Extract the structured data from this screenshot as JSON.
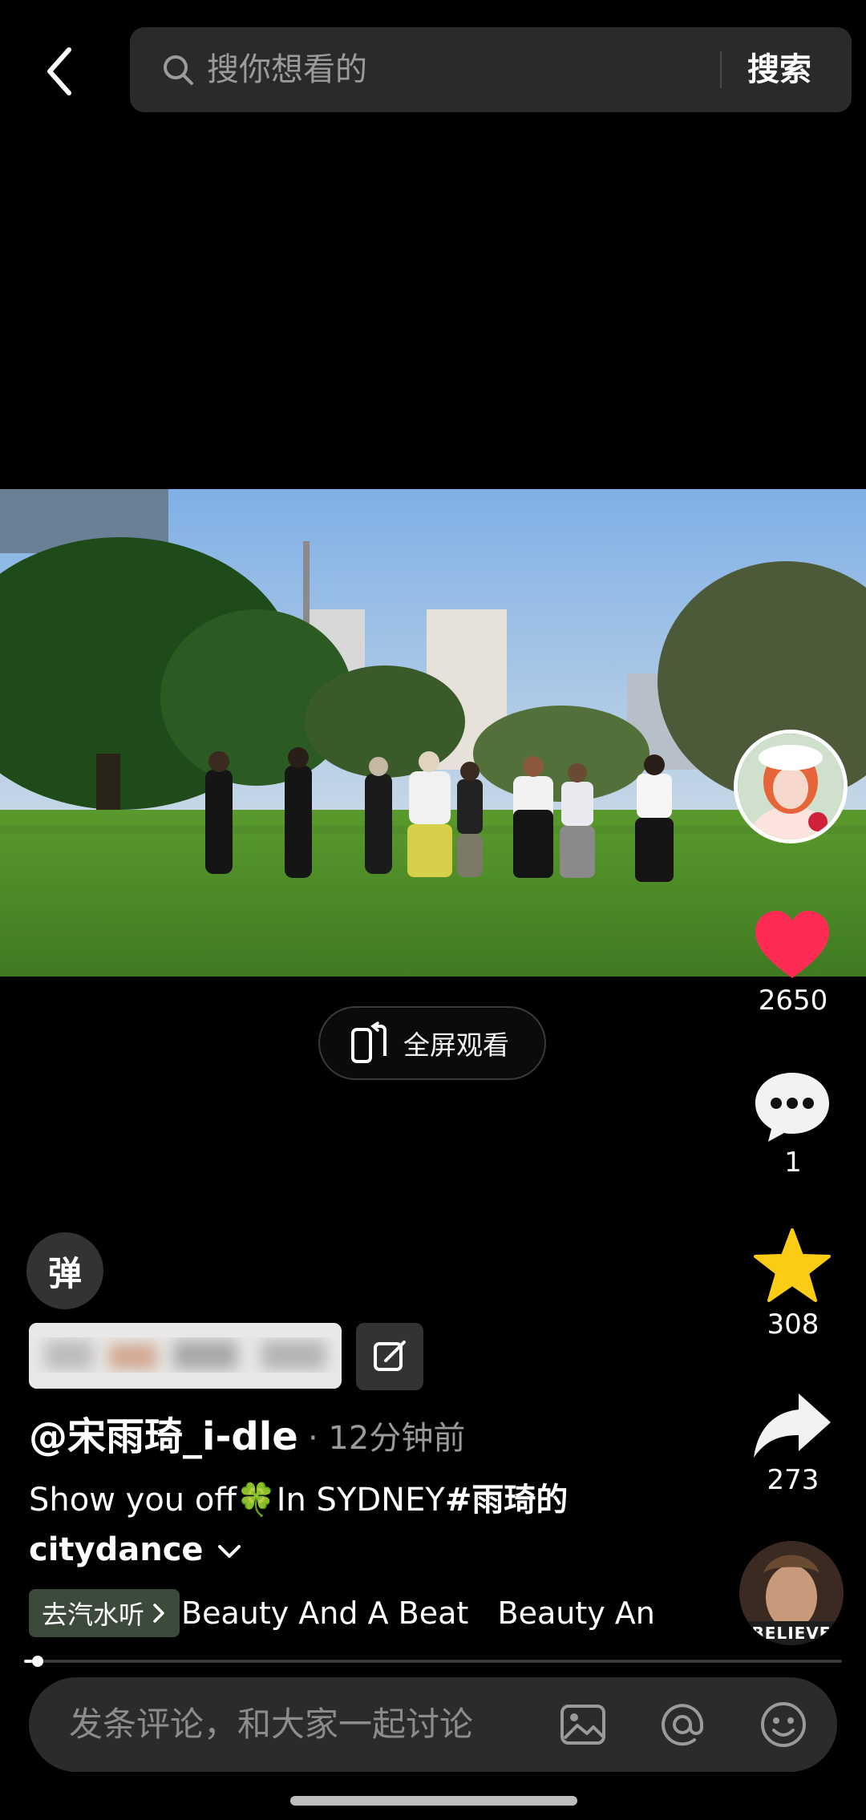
{
  "search": {
    "placeholder": "搜你想看的",
    "button_label": "搜索"
  },
  "video": {
    "fullscreen_label": "全屏观看"
  },
  "actions": {
    "like_count": "2650",
    "comment_count": "1",
    "favorite_count": "308",
    "share_count": "273"
  },
  "danmaku": {
    "label": "弹"
  },
  "post": {
    "author": "@宋雨琦_i-dle",
    "time": "· 12分钟前",
    "caption_text": "Show you off🍀In SYDNEY",
    "caption_tag": "#雨琦的citydance"
  },
  "music": {
    "chip_label": "去汽水听",
    "title": "Beauty And A Beat   Beauty An",
    "disc_text": "BELIEVE"
  },
  "progress": {
    "fraction": 0.01
  },
  "comment": {
    "placeholder": "发条评论，和大家一起讨论"
  },
  "colors": {
    "like": "#fe2c55",
    "favorite": "#facc15",
    "background": "#000000"
  }
}
